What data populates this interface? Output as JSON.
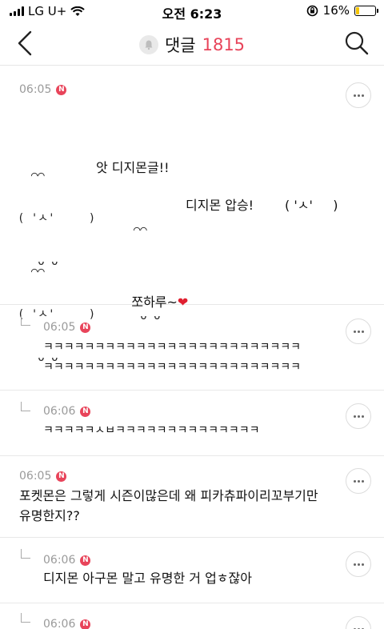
{
  "status": {
    "carrier": "LG U+",
    "time": "오전 6:23",
    "battery_text": "16%",
    "battery_level": 0.16
  },
  "header": {
    "title": "댓글",
    "count": "1815"
  },
  "comments": [
    {
      "time": "06:05",
      "badge": "N",
      "emoticon_top": "  ⌒⌒",
      "emoticon_face_1": "( 'ㅅ'     )",
      "emoticon_bottom": "   ᴗ ᴗ",
      "line1": "앗 디지몬글!!",
      "line2": "디지몬 압승!",
      "face2": "( 'ㅅ'     )",
      "face3": "( 'ㅅ'     )",
      "line3": "쪼하루~",
      "heart": "❤"
    },
    {
      "time": "06:05",
      "badge": "N",
      "text": "ㅋㅋㅋㅋㅋㅋㅋㅋㅋㅋㅋㅋㅋㅋㅋㅋㅋㅋㅋㅋㅋㅋㅋㅋㅋ\nㅋㅋㅋㅋㅋㅋㅋㅋㅋㅋㅋㅋㅋㅋㅋㅋㅋㅋㅋㅋㅋㅋㅋㅋㅋ"
    },
    {
      "time": "06:06",
      "badge": "N",
      "text": "ㅋㅋㅋㅋㅋㅅㅂㅋㅋㅋㅋㅋㅋㅋㅋㅋㅋㅋㅋㅋㅋ"
    },
    {
      "time": "06:05",
      "badge": "N",
      "text": "포켓몬은 그렇게 시즌이많은데 왜 피카츄파이리꼬부기만\n유명한지??"
    },
    {
      "time": "06:06",
      "badge": "N",
      "text": "디지몬 아구몬 말고 유명한 거 업ㅎ잖아"
    },
    {
      "time": "06:06",
      "badge": "N"
    }
  ]
}
